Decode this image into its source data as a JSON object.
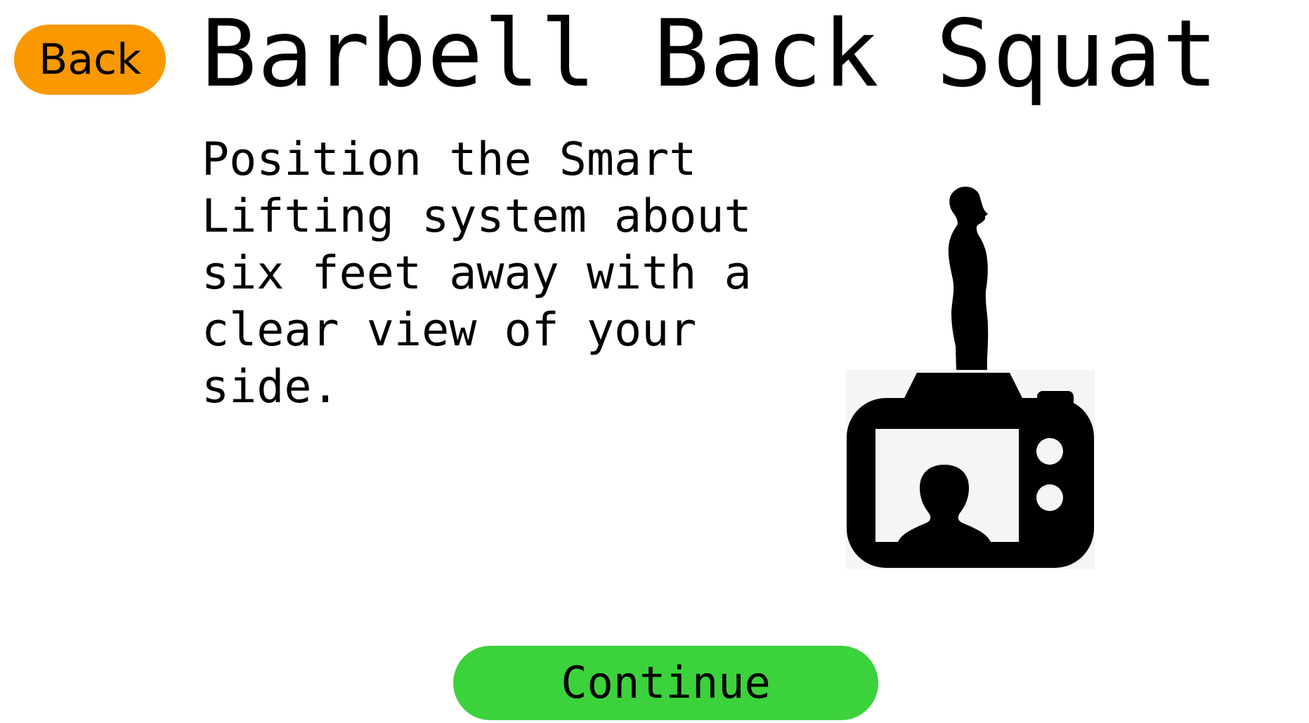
{
  "header": {
    "back_label": "Back",
    "title": "Barbell Back Squat"
  },
  "main": {
    "instructions": "Position the Smart\nLifting system about\nsix feet away with a\nclear view of your\nside.",
    "illustration": {
      "icons": [
        "person-side-silhouette-icon",
        "camera-icon",
        "person-portrait-icon"
      ]
    }
  },
  "footer": {
    "continue_label": "Continue"
  },
  "colors": {
    "back_button": "#fa9800",
    "continue_button": "#3cd23c",
    "background": "#ffffff",
    "text": "#000000"
  }
}
